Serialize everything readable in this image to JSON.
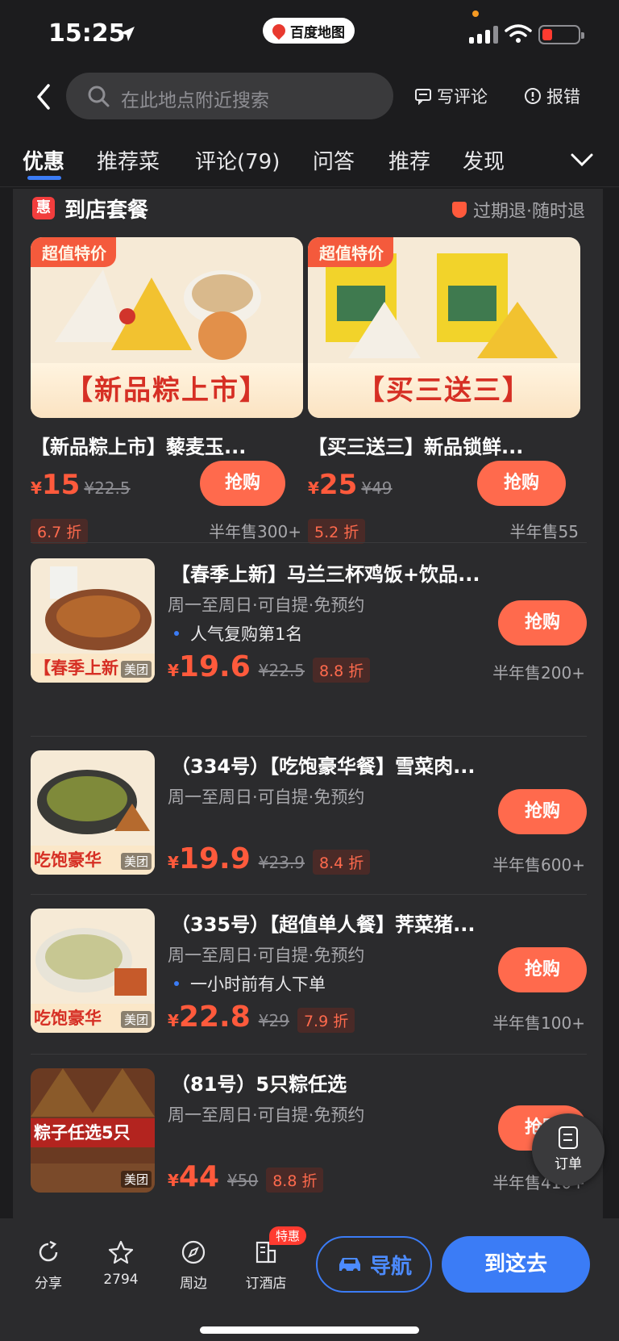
{
  "status": {
    "time": "15:25",
    "app_pill": "百度地图"
  },
  "header": {
    "search_placeholder": "在此地点附近搜索",
    "write_review": "写评论",
    "report_error": "报错"
  },
  "tabs": [
    "优惠",
    "推荐菜",
    "评论(79)",
    "问答",
    "推荐",
    "发现"
  ],
  "section": {
    "icon": "惠",
    "title": "到店套餐",
    "tag": "过期退·随时退"
  },
  "featured": [
    {
      "ribbon": "超值特价",
      "banner": "【新品粽上市】",
      "name": "【新品粽上市】藜麦玉...",
      "yen": "¥",
      "price": "15",
      "orig": "¥22.5",
      "discount": "6.7 折",
      "buy": "抢购",
      "sold": "半年售300+"
    },
    {
      "ribbon": "超值特价",
      "banner": "【买三送三】",
      "name": "【买三送三】新品锁鲜...",
      "yen": "¥",
      "price": "25",
      "orig": "¥49",
      "discount": "5.2 折",
      "buy": "抢购",
      "sold": "半年售55"
    }
  ],
  "deals": [
    {
      "thumb_band": "【春季上新",
      "thumb_brand": "美团",
      "title": "【春季上新】马兰三杯鸡饭+饮品...",
      "sub": "周一至周日·可自提·免预约",
      "highlight": "人气复购第1名",
      "yen": "¥",
      "price": "19.6",
      "orig": "¥22.5",
      "discount": "8.8 折",
      "buy": "抢购",
      "sold": "半年售200+"
    },
    {
      "thumb_band": "吃饱豪华",
      "thumb_brand": "美团",
      "title": "（334号）【吃饱豪华餐】雪菜肉...",
      "sub": "周一至周日·可自提·免预约",
      "highlight": "",
      "yen": "¥",
      "price": "19.9",
      "orig": "¥23.9",
      "discount": "8.4 折",
      "buy": "抢购",
      "sold": "半年售600+"
    },
    {
      "thumb_band": "吃饱豪华",
      "thumb_brand": "美团",
      "title": "（335号）【超值单人餐】荠菜猪...",
      "sub": "周一至周日·可自提·免预约",
      "highlight": "一小时前有人下单",
      "yen": "¥",
      "price": "22.8",
      "orig": "¥29",
      "discount": "7.9 折",
      "buy": "抢购",
      "sold": "半年售100+"
    },
    {
      "thumb_band": "粽子任选5只",
      "thumb_brand": "美团",
      "title": "（81号）5只粽任选",
      "sub": "周一至周日·可自提·免预约",
      "highlight": "",
      "yen": "¥",
      "price": "44",
      "orig": "¥50",
      "discount": "8.8 折",
      "buy": "抢购",
      "sold": "半年售410+"
    }
  ],
  "float_order": "订单",
  "bottom": {
    "share": "分享",
    "favorites": "2794",
    "nearby": "周边",
    "hotel": "订酒店",
    "hotel_badge": "特惠",
    "navigate": "导航",
    "go_here": "到这去"
  },
  "colors": {
    "accent_blue": "#3b7cf6",
    "deal_orange": "#ff6a4d",
    "background": "#1c1c1e"
  }
}
